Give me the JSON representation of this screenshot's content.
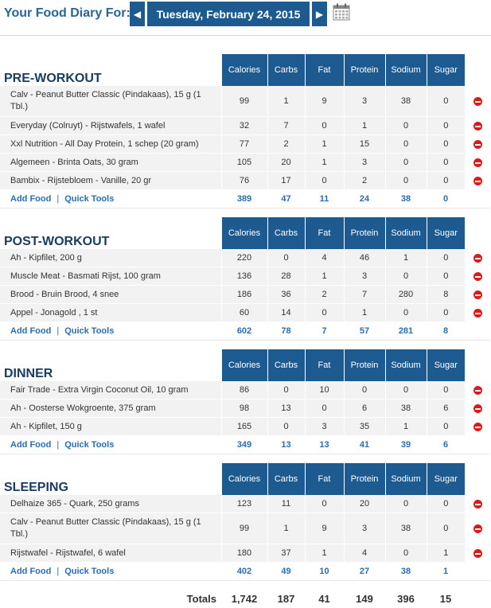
{
  "header": {
    "title": "Your Food Diary For:",
    "date": "Tuesday, February 24, 2015",
    "prev_icon": "chevron-left-icon",
    "next_icon": "chevron-right-icon",
    "calendar_icon": "calendar-icon"
  },
  "columns": [
    "Calories",
    "Carbs",
    "Fat",
    "Protein",
    "Sodium",
    "Sugar"
  ],
  "links": {
    "add_food": "Add Food",
    "quick_tools": "Quick Tools",
    "separator": "|"
  },
  "meals": [
    {
      "name": "PRE-WORKOUT",
      "foods": [
        {
          "name": "Calv - Peanut Butter Classic (Pindakaas), 15 g (1 Tbl.)",
          "calories": "99",
          "carbs": "1",
          "fat": "9",
          "protein": "3",
          "sodium": "38",
          "sugar": "0"
        },
        {
          "name": "Everyday (Colruyt) - Rijstwafels, 1 wafel",
          "calories": "32",
          "carbs": "7",
          "fat": "0",
          "protein": "1",
          "sodium": "0",
          "sugar": "0"
        },
        {
          "name": "Xxl Nutrition - All Day Protein, 1 schep (20 gram)",
          "calories": "77",
          "carbs": "2",
          "fat": "1",
          "protein": "15",
          "sodium": "0",
          "sugar": "0"
        },
        {
          "name": "Algemeen - Brinta Oats, 30 gram",
          "calories": "105",
          "carbs": "20",
          "fat": "1",
          "protein": "3",
          "sodium": "0",
          "sugar": "0"
        },
        {
          "name": "Bambix - Rijstebloem - Vanille, 20 gr",
          "calories": "76",
          "carbs": "17",
          "fat": "0",
          "protein": "2",
          "sodium": "0",
          "sugar": "0"
        }
      ],
      "totals": {
        "calories": "389",
        "carbs": "47",
        "fat": "11",
        "protein": "24",
        "sodium": "38",
        "sugar": "0"
      }
    },
    {
      "name": "POST-WORKOUT",
      "foods": [
        {
          "name": "Ah - Kipfilet, 200 g",
          "calories": "220",
          "carbs": "0",
          "fat": "4",
          "protein": "46",
          "sodium": "1",
          "sugar": "0"
        },
        {
          "name": "Muscle Meat - Basmati Rijst, 100 gram",
          "calories": "136",
          "carbs": "28",
          "fat": "1",
          "protein": "3",
          "sodium": "0",
          "sugar": "0"
        },
        {
          "name": "Brood - Bruin Brood, 4 snee",
          "calories": "186",
          "carbs": "36",
          "fat": "2",
          "protein": "7",
          "sodium": "280",
          "sugar": "8"
        },
        {
          "name": "Appel - Jonagold , 1 st",
          "calories": "60",
          "carbs": "14",
          "fat": "0",
          "protein": "1",
          "sodium": "0",
          "sugar": "0"
        }
      ],
      "totals": {
        "calories": "602",
        "carbs": "78",
        "fat": "7",
        "protein": "57",
        "sodium": "281",
        "sugar": "8"
      }
    },
    {
      "name": "DINNER",
      "foods": [
        {
          "name": "Fair Trade - Extra Virgin Coconut Oil, 10 gram",
          "calories": "86",
          "carbs": "0",
          "fat": "10",
          "protein": "0",
          "sodium": "0",
          "sugar": "0"
        },
        {
          "name": "Ah - Oosterse Wokgroente, 375 gram",
          "calories": "98",
          "carbs": "13",
          "fat": "0",
          "protein": "6",
          "sodium": "38",
          "sugar": "6"
        },
        {
          "name": "Ah - Kipfilet, 150 g",
          "calories": "165",
          "carbs": "0",
          "fat": "3",
          "protein": "35",
          "sodium": "1",
          "sugar": "0"
        }
      ],
      "totals": {
        "calories": "349",
        "carbs": "13",
        "fat": "13",
        "protein": "41",
        "sodium": "39",
        "sugar": "6"
      }
    },
    {
      "name": "SLEEPING",
      "foods": [
        {
          "name": "Delhaize 365 - Quark, 250 grams",
          "calories": "123",
          "carbs": "11",
          "fat": "0",
          "protein": "20",
          "sodium": "0",
          "sugar": "0"
        },
        {
          "name": "Calv - Peanut Butter Classic (Pindakaas), 15 g (1 Tbl.)",
          "calories": "99",
          "carbs": "1",
          "fat": "9",
          "protein": "3",
          "sodium": "38",
          "sugar": "0"
        },
        {
          "name": "Rijstwafel - Rijstwafel, 6 wafel",
          "calories": "180",
          "carbs": "37",
          "fat": "1",
          "protein": "4",
          "sodium": "0",
          "sugar": "1"
        }
      ],
      "totals": {
        "calories": "402",
        "carbs": "49",
        "fat": "10",
        "protein": "27",
        "sodium": "38",
        "sugar": "1"
      }
    }
  ],
  "grand_totals": {
    "label": "Totals",
    "calories": "1,742",
    "carbs": "187",
    "fat": "41",
    "protein": "149",
    "sodium": "396",
    "sugar": "15"
  },
  "colors": {
    "header_blue": "#1d5a8f",
    "link_blue": "#2a6db0",
    "delete_red": "#d91b1b",
    "row_gray": "#f2f2f2"
  }
}
